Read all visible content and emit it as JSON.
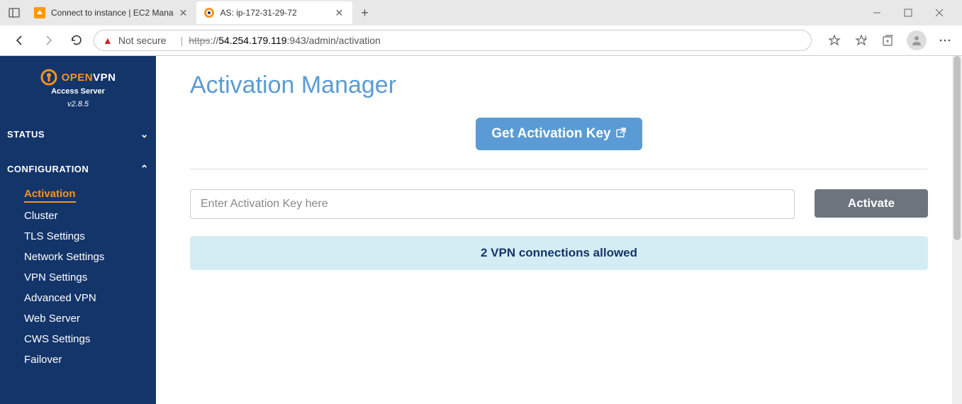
{
  "browser": {
    "tabs": [
      {
        "title": "Connect to instance | EC2 Mana",
        "active": false
      },
      {
        "title": "AS: ip-172-31-29-72",
        "active": true
      }
    ],
    "security_label": "Not secure",
    "url_scheme": "https",
    "url_host": "54.254.179.119",
    "url_port_path": ":943/admin/activation"
  },
  "sidebar": {
    "brand_open": "OPEN",
    "brand_vpn": "VPN",
    "brand_sub": "Access Server",
    "version": "v2.8.5",
    "sections": [
      {
        "label": "STATUS",
        "expanded": false
      },
      {
        "label": "CONFIGURATION",
        "expanded": true
      }
    ],
    "config_items": [
      {
        "label": "Activation",
        "active": true
      },
      {
        "label": "Cluster",
        "active": false
      },
      {
        "label": "TLS Settings",
        "active": false
      },
      {
        "label": "Network Settings",
        "active": false
      },
      {
        "label": "VPN Settings",
        "active": false
      },
      {
        "label": "Advanced VPN",
        "active": false
      },
      {
        "label": "Web Server",
        "active": false
      },
      {
        "label": "CWS Settings",
        "active": false
      },
      {
        "label": "Failover",
        "active": false
      }
    ]
  },
  "main": {
    "title": "Activation Manager",
    "get_key_label": "Get Activation Key",
    "input_placeholder": "Enter Activation Key here",
    "activate_label": "Activate",
    "info_text": "2 VPN connections allowed"
  }
}
